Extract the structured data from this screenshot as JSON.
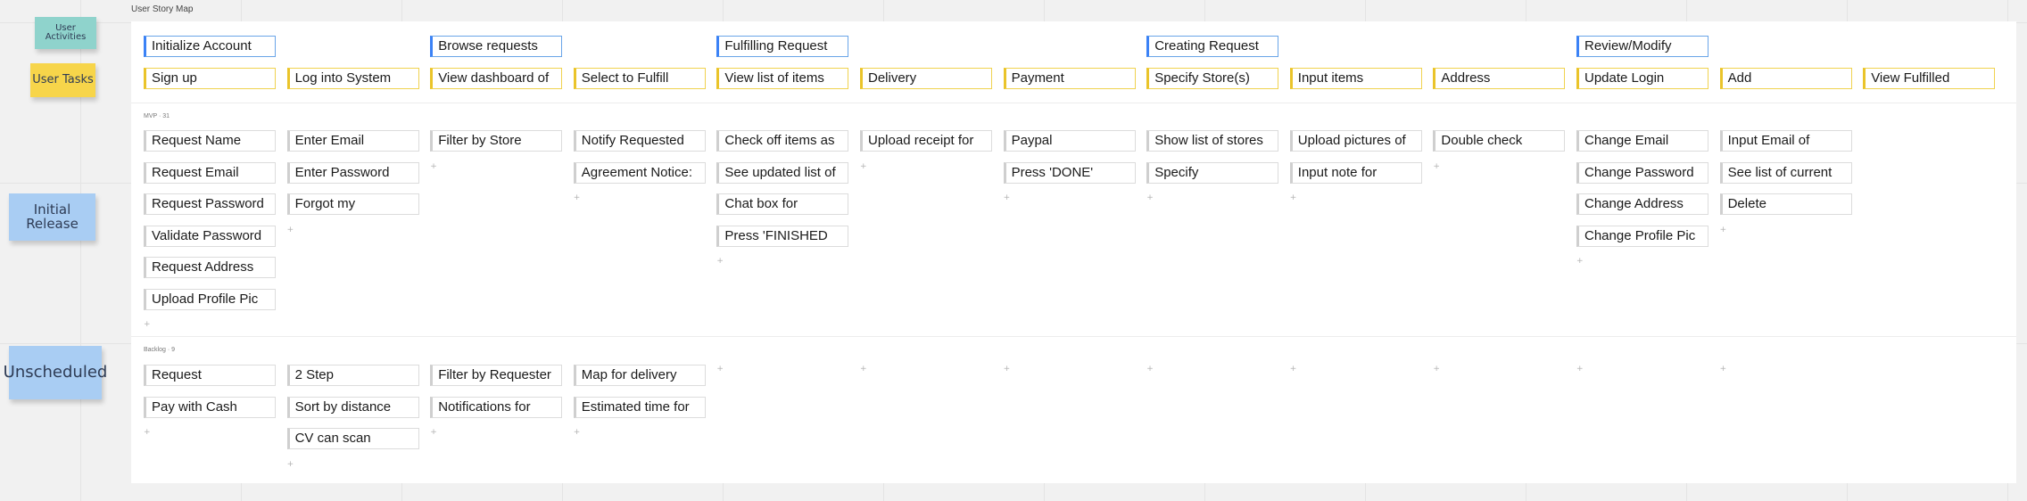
{
  "board_title": "User Story Map",
  "stickies": {
    "user_activities": "User Activities",
    "user_tasks": "User Tasks",
    "initial_release": "Initial Release",
    "unscheduled": "Unscheduled"
  },
  "sections": {
    "mvp": "MVP · 31",
    "backlog": "Backlog · 9"
  },
  "plus_symbol": "+",
  "columns": [
    {
      "activity": "Initialize Account",
      "task": "Sign up",
      "mvp": [
        "Request Name",
        "Request Email",
        "Request Password",
        "Validate Password",
        "Request Address",
        "Upload Profile Pic"
      ],
      "backlog": [
        "Request",
        "Pay with Cash"
      ]
    },
    {
      "activity": "",
      "task": "Log into System",
      "mvp": [
        "Enter Email",
        "Enter Password",
        "Forgot my"
      ],
      "backlog": [
        "2 Step",
        "Sort by distance",
        "CV can scan"
      ]
    },
    {
      "activity": "Browse requests",
      "task": "View dashboard of",
      "mvp": [
        "Filter by Store"
      ],
      "backlog": [
        "Filter by Requester",
        "Notifications for"
      ]
    },
    {
      "activity": "",
      "task": "Select to Fulfill",
      "mvp": [
        "Notify Requested",
        "Agreement Notice:"
      ],
      "backlog": [
        "Map for delivery",
        "Estimated time for"
      ]
    },
    {
      "activity": "Fulfilling Request",
      "task": "View list of items",
      "mvp": [
        "Check off items as",
        "See updated list of",
        "Chat box for",
        "Press 'FINISHED"
      ],
      "backlog": []
    },
    {
      "activity": "",
      "task": "Delivery",
      "mvp": [
        "Upload receipt for"
      ],
      "backlog": []
    },
    {
      "activity": "",
      "task": "Payment",
      "mvp": [
        "Paypal",
        "Press 'DONE'"
      ],
      "backlog": []
    },
    {
      "activity": "Creating Request",
      "task": "Specify Store(s)",
      "mvp": [
        "Show list of stores",
        "Specify"
      ],
      "backlog": []
    },
    {
      "activity": "",
      "task": "Input items",
      "mvp": [
        "Upload pictures of",
        "Input note for"
      ],
      "backlog": []
    },
    {
      "activity": "",
      "task": "Address",
      "mvp": [
        "Double check"
      ],
      "backlog": []
    },
    {
      "activity": "Review/Modify",
      "task": "Update Login",
      "mvp": [
        "Change Email",
        "Change Password",
        "Change Address",
        "Change Profile Pic"
      ],
      "backlog": []
    },
    {
      "activity": "",
      "task": "Add",
      "mvp": [
        "Input Email of",
        "See list of current",
        "Delete"
      ],
      "backlog": []
    },
    {
      "activity": "",
      "task": "View Fulfilled",
      "mvp": [],
      "backlog": []
    }
  ],
  "colors": {
    "activity_border": "#3b82f6",
    "task_border": "#eac42a",
    "sticky_teal": "#8fd3cc",
    "sticky_yellow": "#f7d54a",
    "sticky_blue": "#a9cdf3"
  }
}
